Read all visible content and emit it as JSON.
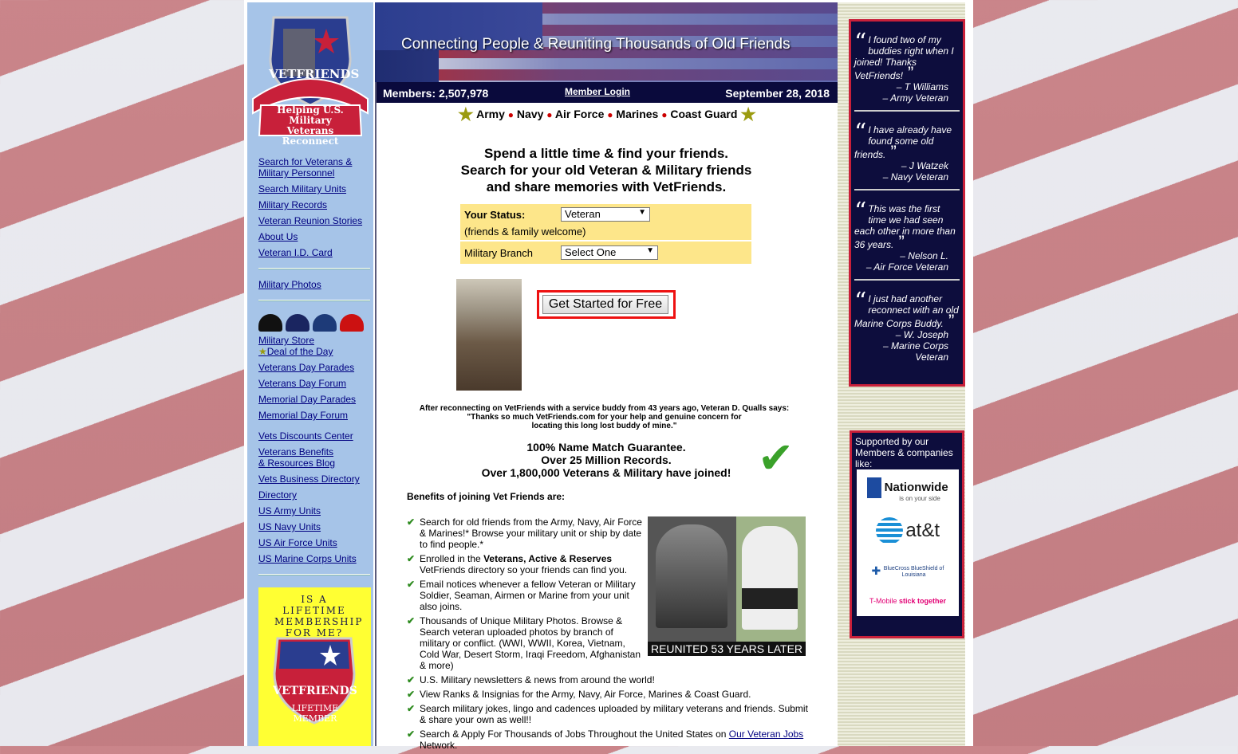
{
  "banner": {
    "tagline": "Connecting People & Reuniting Thousands of Old Friends"
  },
  "logo": {
    "name": "VETFRIENDS",
    "motto": "Helping U.S. Military Veterans Reconnect"
  },
  "infobar": {
    "members": "Members: 2,507,978",
    "login": "Member Login",
    "date": "September 28, 2018"
  },
  "branches": [
    "Army",
    "Navy",
    "Air Force",
    "Marines",
    "Coast Guard"
  ],
  "headline": [
    "Spend a little time & find your friends.",
    "Search for your old Veteran & Military friends",
    "and share memories with VetFriends."
  ],
  "form": {
    "status_label": "Your Status:",
    "status_value": "Veteran",
    "status_sub": "(friends & family welcome)",
    "branch_label": "Military Branch",
    "branch_value": "Select One"
  },
  "cta": "Get Started for Free",
  "quote": {
    "line1": "After reconnecting on VetFriends with a service buddy from 43 years ago, Veteran D. Qualls says:",
    "line2": "\"Thanks so much VetFriends.com for your help and genuine concern for",
    "line3": "locating this long lost buddy of mine.\""
  },
  "guarantee": [
    "100% Name Match Guarantee.",
    "Over 25 Million Records.",
    "Over 1,800,000 Veterans & Military have joined!"
  ],
  "benefits_title": "Benefits of joining Vet Friends are:",
  "benefits": [
    "Search for old friends from the Army, Navy, Air Force & Marines!* Browse your military unit or ship by date to find people.*",
    "Enrolled in the ",
    "Email notices whenever a fellow Veteran or Military Soldier, Seaman, Airmen or Marine from your unit also joins.",
    "Thousands of Unique Military Photos. Browse & Search veteran uploaded photos by branch of military or conflict. (WWI, WWII, Korea, Vietnam, Cold War, Desert Storm, Iraqi Freedom, Afghanistan & more)",
    "U.S. Military newsletters & news from around the world!",
    "View Ranks & Insignias for the Army, Navy, Air Force, Marines & Coast Guard.",
    "Search military jokes, lingo and cadences uploaded by military veterans and friends. Submit & share your own as well!!",
    "Search & Apply For Thousands of Jobs Throughout the United States on "
  ],
  "benefit2_bold": "Veterans, Active & Reserves",
  "benefit2_tail": " VetFriends directory so your friends can find you.",
  "benefit8_link": "Our Veteran Jobs",
  "benefit8_tail": " Network.",
  "photo_caption": "REUNITED 53 YEARS LATER",
  "nav": [
    "Search for Veterans & Military Personnel",
    "Search Military Units",
    "Military Records",
    "Veteran Reunion Stories",
    "About Us",
    "Veteran I.D. Card",
    "Military Photos",
    "Military Store ",
    "Deal of the Day",
    "Veterans Day Parades",
    "Veterans Day Forum",
    "Memorial Day Parades",
    "Memorial Day Forum",
    "Vets Discounts Center",
    "Veterans Benefits & Resources Blog",
    "Vets Business Directory",
    "Directory",
    "US Army Units",
    "US Navy Units",
    "US Air Force Units",
    "US Marine Corps Units"
  ],
  "caps": [
    "ARMY",
    "NAVY",
    "USAF",
    "USMC"
  ],
  "promo": {
    "text": "IS A LIFETIME MEMBERSHIP FOR ME?",
    "badge": "VETFRIENDS",
    "badge_sub": "LIFETIME MEMBER"
  },
  "testimonials": [
    {
      "text": "I found two of my buddies right when I joined! Thanks VetFriends!",
      "name": "– T Williams",
      "role": "– Army Veteran"
    },
    {
      "text": "I have already have found some old friends.",
      "name": "– J Watzek",
      "role": "– Navy Veteran"
    },
    {
      "text": "This was the first time we had seen each other in more than 36 years.",
      "name": "– Nelson L.",
      "role": "– Air Force Veteran"
    },
    {
      "text": "I just had another reconnect with an old Marine Corps Buddy.",
      "name": "– W. Joseph",
      "role": "– Marine Corps Veteran"
    }
  ],
  "support": {
    "title": "Supported by our Members & companies like:",
    "sponsors": [
      "Nationwide",
      "is on your side",
      "at&t",
      "BlueCross BlueShield of Louisiana",
      "T-Mobile",
      "stick together"
    ]
  },
  "colors": {
    "navy": "#0a0a3c",
    "red": "#c8203a",
    "yellow": "#ffff33",
    "form_bg": "#fde68a",
    "sidebar": "#a6c4e8"
  }
}
